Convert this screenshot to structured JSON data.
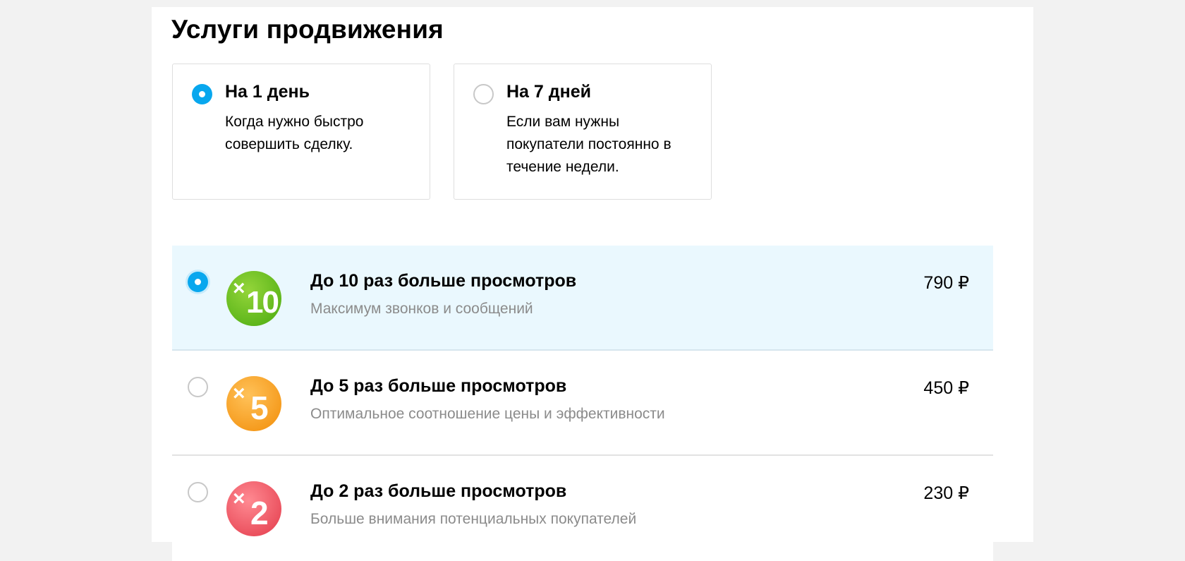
{
  "title": "Услуги продвижения",
  "durations": [
    {
      "title": "На 1 день",
      "description": "Когда нужно быстро совершить сделку.",
      "selected": true
    },
    {
      "title": "На 7 дней",
      "description": "Если вам нужны покупатели постоянно в течение недели.",
      "selected": false
    }
  ],
  "options": [
    {
      "badge_symbol": "×",
      "badge_multiplier": "10",
      "badge_color": "#6cc22a",
      "title": "До 10 раз больше просмотров",
      "subtitle": "Максимум звонков и сообщений",
      "price": "790 ₽",
      "selected": true
    },
    {
      "badge_symbol": "×",
      "badge_multiplier": "5",
      "badge_color": "#f7a42a",
      "title": "До 5 раз больше просмотров",
      "subtitle": "Оптимальное соотношение цены и эффективности",
      "price": "450 ₽",
      "selected": false
    },
    {
      "badge_symbol": "×",
      "badge_multiplier": "2",
      "badge_color": "#f06470",
      "title": "До 2 раз больше просмотров",
      "subtitle": "Больше внимания потенциальных покупателей",
      "price": "230 ₽",
      "selected": false
    }
  ],
  "colors": {
    "accent": "#08a7ee",
    "selected_row_bg": "#eaf8fe",
    "muted_text": "#8b8b8b"
  }
}
